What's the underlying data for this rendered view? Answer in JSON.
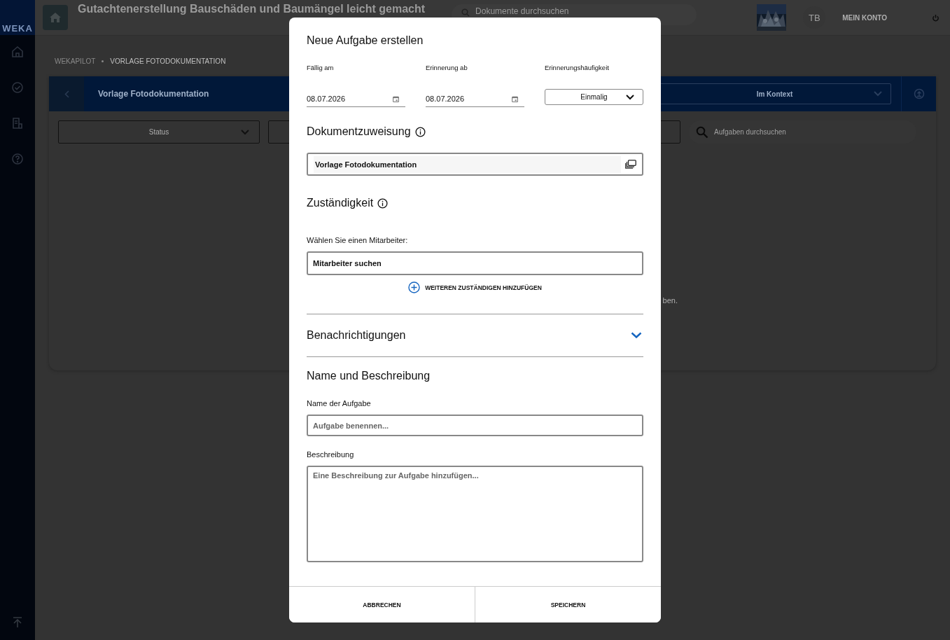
{
  "header": {
    "title": "Gutachtenerstellung Bauschäden und Baumängel leicht gemacht",
    "search": {
      "placeholder": "Dokumente durchsuchen"
    },
    "initials": "TB",
    "account": "MEIN KONTO"
  },
  "sidebar": {
    "logo": "WEKA"
  },
  "breadcrumb": [
    {
      "label": "WEKAPILOT",
      "selected": false
    },
    {
      "label": "VORLAGE FOTODOKUMENTATION",
      "selected": true
    }
  ],
  "panel": {
    "title": "Vorlage Fotodokumentation",
    "context": "Im Kontext",
    "filters": [
      "Status"
    ],
    "search": {
      "placeholder": "Aufgaben durchsuchen"
    },
    "message": "ben."
  },
  "dialog": {
    "title": "Neue Aufgabe erstellen",
    "dates": [
      {
        "label": "Fällig am",
        "value": "08.07.2026"
      },
      {
        "label": "Erinnerung ab",
        "value": "08.07.2026"
      }
    ],
    "frequency": {
      "label": "Erinnerungshäufigkeit",
      "value": "Einmalig"
    },
    "document": {
      "heading": "Dokumentzuweisung",
      "value": "Vorlage Fotodokumentation"
    },
    "responsibility": {
      "heading": "Zuständigkeit",
      "label": "Wählen Sie einen Mitarbeiter:",
      "placeholder": "Mitarbeiter suchen",
      "add": "WEITEREN ZUSTÄNDIGEN HINZUFÜGEN"
    },
    "notifications": {
      "heading": "Benachrichtigungen",
      "expanded": false
    },
    "details": {
      "heading": "Name und Beschreibung",
      "name_label": "Name der Aufgabe",
      "name_placeholder": "Aufgabe benennen...",
      "description_label": "Beschreibung",
      "description_placeholder": "Eine Beschreibung zur Aufgabe hinzufügen..."
    },
    "buttons": [
      "ABBRECHEN",
      "SPEICHERN"
    ]
  }
}
